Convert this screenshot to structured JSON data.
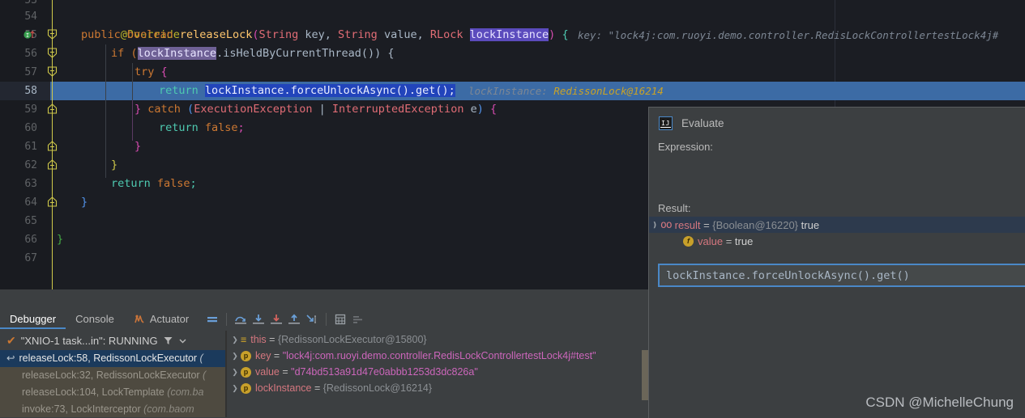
{
  "editor": {
    "lines": [
      {
        "num": "53",
        "partial": true
      },
      {
        "num": "54"
      },
      {
        "num": "55"
      },
      {
        "num": "56"
      },
      {
        "num": "57"
      },
      {
        "num": "58",
        "current": true
      },
      {
        "num": "59"
      },
      {
        "num": "60"
      },
      {
        "num": "61"
      },
      {
        "num": "62"
      },
      {
        "num": "63"
      },
      {
        "num": "64"
      },
      {
        "num": "65"
      },
      {
        "num": "66"
      },
      {
        "num": "67"
      }
    ],
    "code": {
      "l54": "@Override",
      "l55_a": "public boolean ",
      "l55_method": "releaseLock",
      "l55_b": "(String key, String value, RLock ",
      "l55_param": "lockInstance",
      "l55_c": ") {",
      "l55_hint": "key: \"lock4j:com.ruoyi.demo.controller.RedisLockControllertestLock4j#",
      "l56_a": "if (",
      "l56_var": "lockInstance",
      "l56_b": ".isHeldByCurrentThread()) {",
      "l57": "try {",
      "l58_kw": "return ",
      "l58_expr": "lockInstance.forceUnlockAsync().get();",
      "l58_hint_label": "lockInstance:",
      "l58_hint_value": "RedissonLock@16214",
      "l59": "} catch (ExecutionException | InterruptedException e) {",
      "l60": "return false;",
      "l61": "}",
      "l62": "}",
      "l63": "return false;",
      "l64": "}",
      "l66": "}"
    },
    "gutter_icons": {
      "override": "override-method-icon",
      "fold": "fold-collapse-icon"
    }
  },
  "evaluate": {
    "title": "Evaluate",
    "logo_text": "IJ",
    "expression_label": "Expression:",
    "expression_value": "lockInstance.forceUnlockAsync().get()",
    "result_label": "Result:",
    "result_rows": [
      {
        "icon": "watch-result-icon",
        "name": "result",
        "eq": " = ",
        "type": "{Boolean@16220}",
        "value": " true",
        "selected": true,
        "expanded": true
      },
      {
        "icon": "field-icon",
        "name": "value",
        "eq": " = ",
        "type": "",
        "value": "true",
        "selected": false,
        "child": true
      }
    ]
  },
  "debugger": {
    "tabs": [
      {
        "label": "Debugger",
        "active": true
      },
      {
        "label": "Console",
        "active": false
      },
      {
        "label": "Actuator",
        "active": false,
        "icon": "actuator-icon"
      }
    ],
    "toolbar_icons": [
      "mute-breakpoints-icon",
      "step-over-icon",
      "step-into-icon",
      "force-step-into-icon",
      "step-out-icon",
      "run-to-cursor-icon",
      "evaluate-expression-icon",
      "show-frames-icon"
    ],
    "thread": {
      "status_icon": "thread-running-check-icon",
      "label": "\"XNIO-1 task...in\": RUNNING",
      "filter_icon": "filter-icon",
      "dropdown_icon": "chevron-down-icon"
    },
    "frames": [
      {
        "text": "releaseLock:58, RedissonLockExecutor",
        "pkg": " (",
        "selected": true,
        "icon": "current-frame-icon"
      },
      {
        "text": "releaseLock:32, RedissonLockExecutor",
        "pkg": " (",
        "selected": false
      },
      {
        "text": "releaseLock:104, LockTemplate ",
        "pkg": "(com.ba",
        "selected": false
      },
      {
        "text": "invoke:73, LockInterceptor ",
        "pkg": "(com.baom",
        "selected": false
      }
    ],
    "variables": [
      {
        "icon": "this-object-icon",
        "name": "this",
        "eq": " = ",
        "value": "{RedissonLockExecutor@15800}",
        "type": "obj"
      },
      {
        "icon": "parameter-icon",
        "name": "key",
        "eq": " = ",
        "value": "\"lock4j:com.ruoyi.demo.controller.RedisLockControllertestLock4j#test\"",
        "type": "str"
      },
      {
        "icon": "parameter-icon",
        "name": "value",
        "eq": " = ",
        "value": "\"d74bd513a91d47e0abbb1253d3dc826a\"",
        "type": "str"
      },
      {
        "icon": "parameter-icon",
        "name": "lockInstance",
        "eq": " = ",
        "value": "{RedissonLock@16214}",
        "type": "obj"
      }
    ]
  },
  "watermark": "CSDN @MichelleChung",
  "colors": {
    "editor_bg": "#1b1d23",
    "panel_bg": "#3c3f41",
    "accent_blue": "#4a88c7",
    "current_line": "#3c6ba5",
    "frames_bg": "#4e4a40"
  }
}
